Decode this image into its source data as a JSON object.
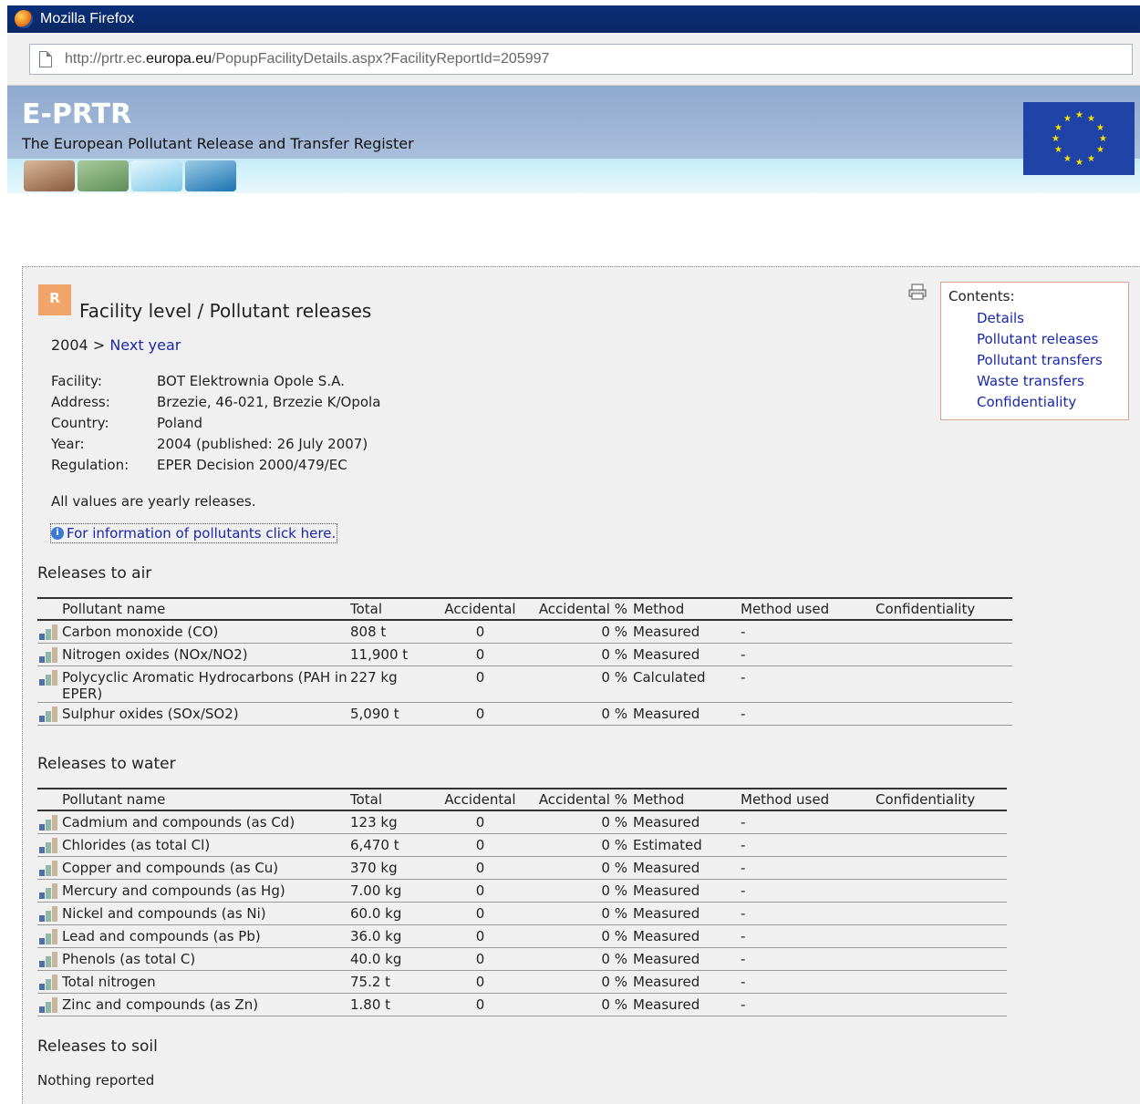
{
  "browser": {
    "title": "Mozilla Firefox",
    "url_prefix": "http://prtr.ec.",
    "url_domain": "europa.eu",
    "url_suffix": "/PopupFacilityDetails.aspx?FacilityReportId=205997"
  },
  "header": {
    "logo_text": "E-PRTR",
    "subtitle": "The European Pollutant Release and Transfer Register"
  },
  "page": {
    "icon_letter": "R",
    "title": "Facility level / Pollutant releases",
    "year": "2004",
    "next_sep": ">",
    "next_link": "Next year",
    "facts": [
      {
        "k": "Facility:",
        "v": "BOT Elektrownia Opole S.A."
      },
      {
        "k": "Address:",
        "v": "Brzezie, 46-021, Brzezie K/Opola"
      },
      {
        "k": "Country:",
        "v": "Poland"
      },
      {
        "k": "Year:",
        "v": "2004 (published: 26 July 2007)"
      },
      {
        "k": "Regulation:",
        "v": "EPER Decision 2000/479/EC"
      }
    ],
    "note": "All values are yearly releases.",
    "info_link": "For information of pollutants click here."
  },
  "contents": {
    "label": "Contents:",
    "links": [
      "Details",
      "Pollutant releases",
      "Pollutant transfers",
      "Waste transfers",
      "Confidentiality"
    ]
  },
  "table_headers": [
    "Pollutant name",
    "Total",
    "Accidental",
    "Accidental %",
    "Method",
    "Method used",
    "Confidentiality"
  ],
  "air": {
    "title": "Releases to air",
    "rows": [
      [
        "Carbon monoxide (CO)",
        "808 t",
        "0",
        "0 %",
        "Measured",
        "-",
        ""
      ],
      [
        "Nitrogen oxides (NOx/NO2)",
        "11,900 t",
        "0",
        "0 %",
        "Measured",
        "-",
        ""
      ],
      [
        "Polycyclic Aromatic Hydrocarbons (PAH in EPER)",
        "227 kg",
        "0",
        "0 %",
        "Calculated",
        "-",
        ""
      ],
      [
        "Sulphur oxides (SOx/SO2)",
        "5,090 t",
        "0",
        "0 %",
        "Measured",
        "-",
        ""
      ]
    ]
  },
  "water": {
    "title": "Releases to water",
    "rows": [
      [
        "Cadmium and compounds (as Cd)",
        "123 kg",
        "0",
        "0 %",
        "Measured",
        "-",
        ""
      ],
      [
        "Chlorides (as total Cl)",
        "6,470 t",
        "0",
        "0 %",
        "Estimated",
        "-",
        ""
      ],
      [
        "Copper and compounds (as Cu)",
        "370 kg",
        "0",
        "0 %",
        "Measured",
        "-",
        ""
      ],
      [
        "Mercury and compounds (as Hg)",
        "7.00 kg",
        "0",
        "0 %",
        "Measured",
        "-",
        ""
      ],
      [
        "Nickel and compounds (as Ni)",
        "60.0 kg",
        "0",
        "0 %",
        "Measured",
        "-",
        ""
      ],
      [
        "Lead and compounds (as Pb)",
        "36.0 kg",
        "0",
        "0 %",
        "Measured",
        "-",
        ""
      ],
      [
        "Phenols (as total C)",
        "40.0 kg",
        "0",
        "0 %",
        "Measured",
        "-",
        ""
      ],
      [
        "Total nitrogen",
        "75.2 t",
        "0",
        "0 %",
        "Measured",
        "-",
        ""
      ],
      [
        "Zinc and compounds (as Zn)",
        "1.80 t",
        "0",
        "0 %",
        "Measured",
        "-",
        ""
      ]
    ]
  },
  "soil": {
    "title": "Releases to soil",
    "nothing": "Nothing reported"
  }
}
